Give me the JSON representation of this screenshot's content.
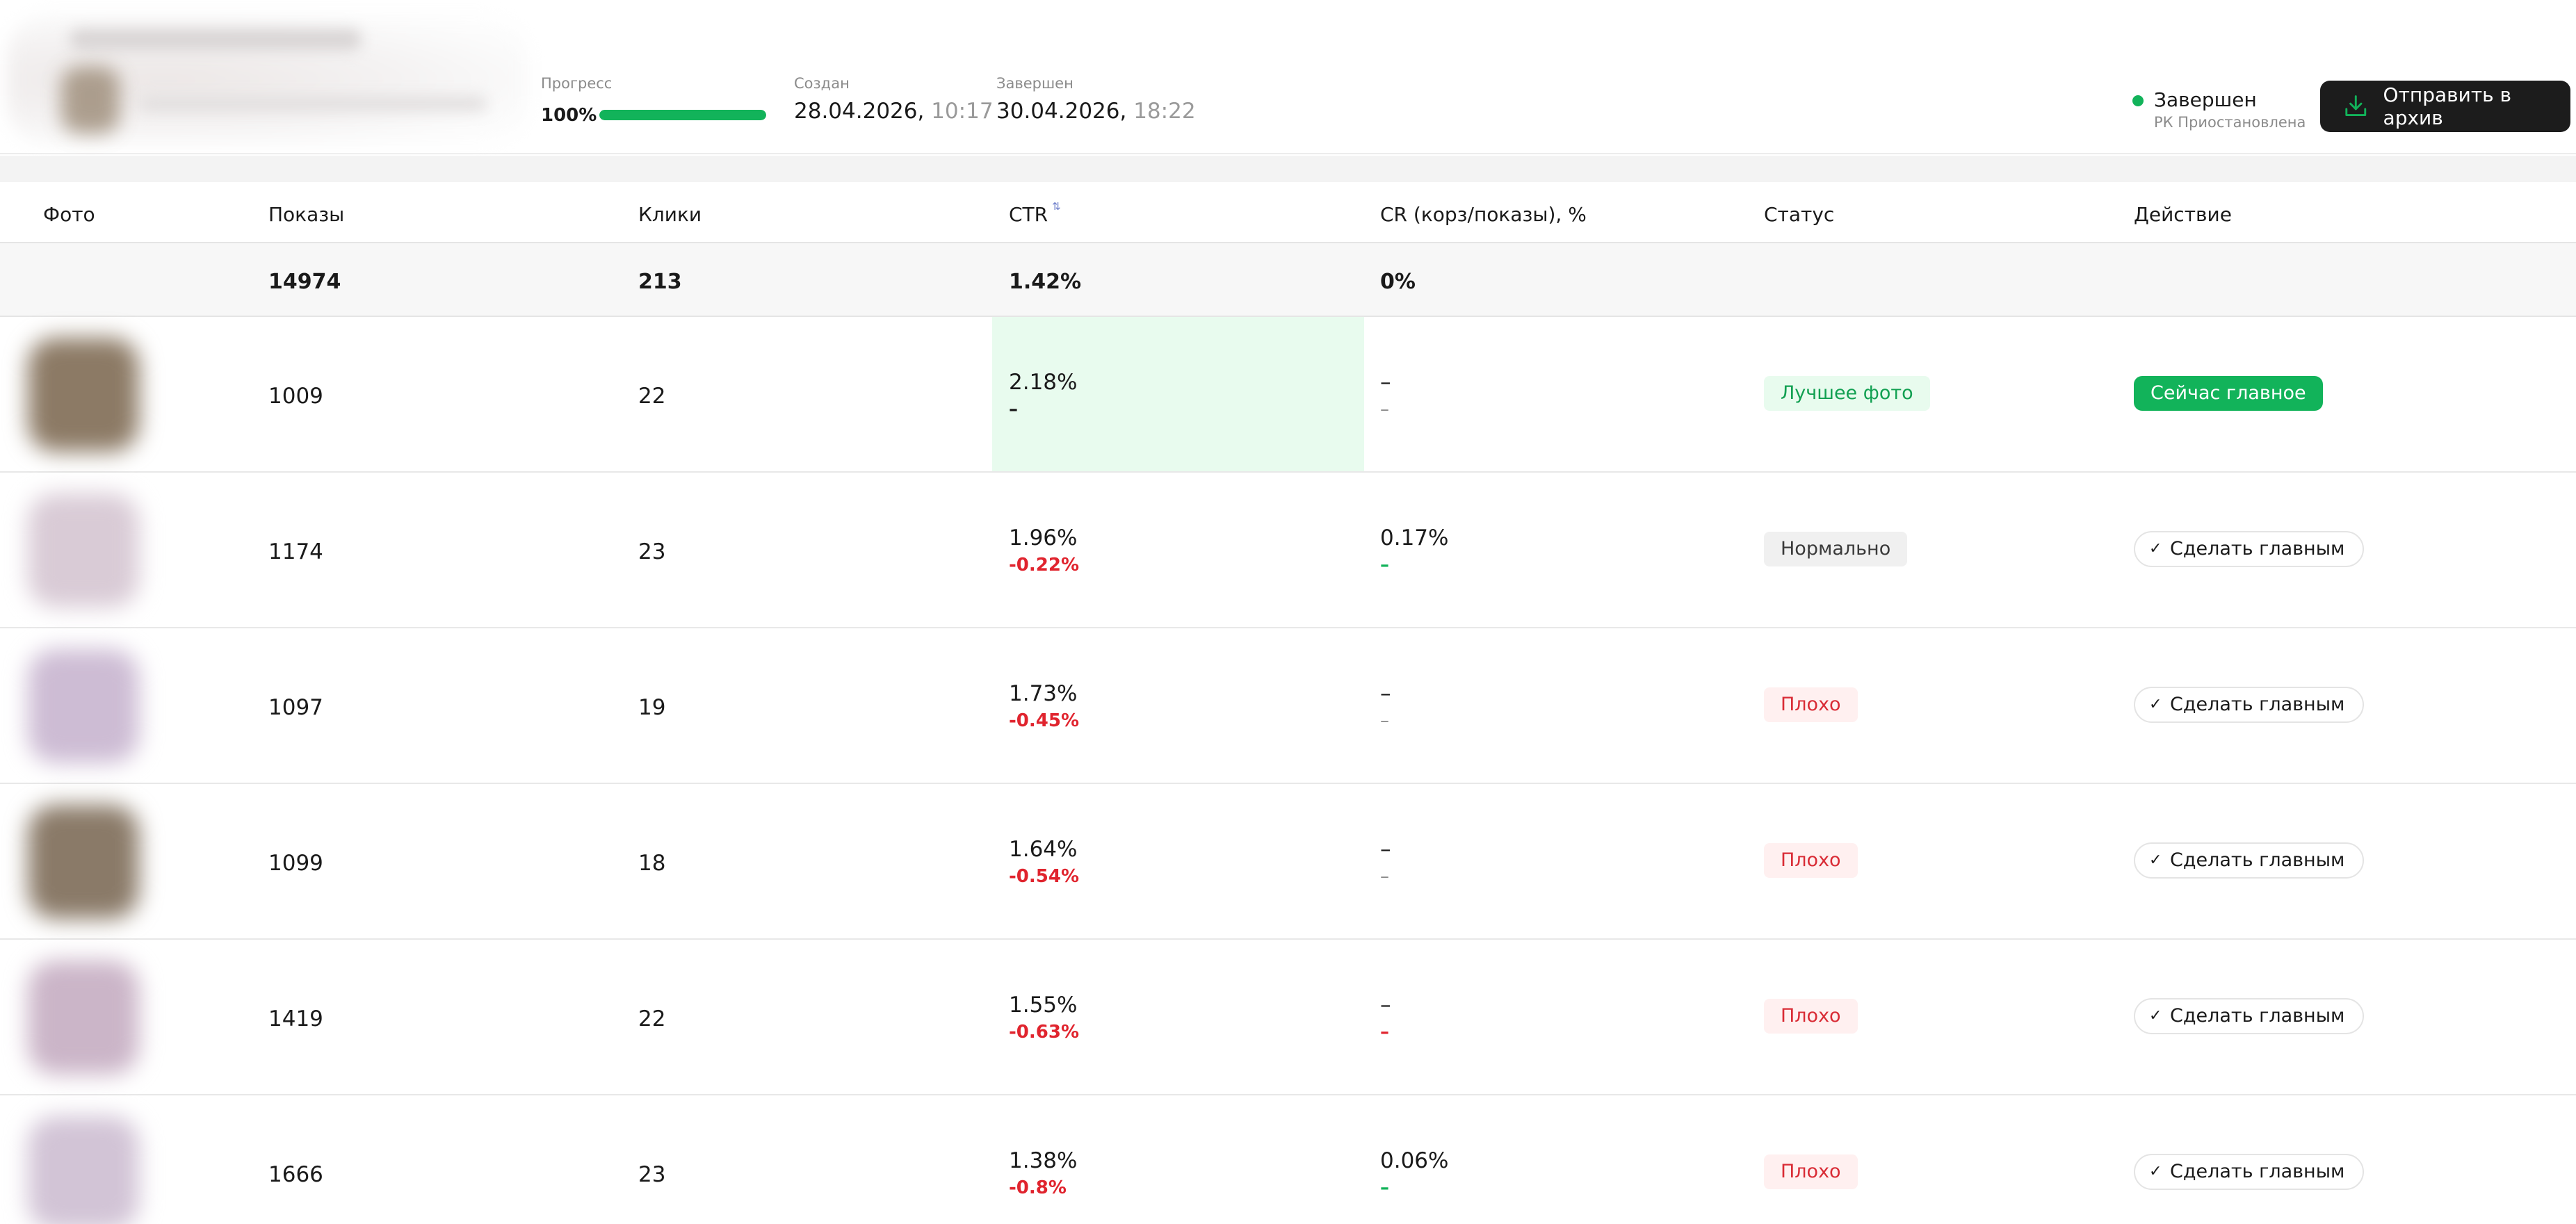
{
  "header": {
    "progress_label": "Прогресс",
    "progress_value": "100%",
    "progress_fraction": 1.0,
    "created_label": "Создан",
    "created_date": "28.04.2026,",
    "created_time": " 10:17",
    "finished_label": "Завершен",
    "finished_date": "30.04.2026,",
    "finished_time": " 18:22",
    "status_title": "Завершен",
    "status_subtitle": "РК Приостановлена",
    "archive_button": "Отправить в архив"
  },
  "table": {
    "columns": {
      "photo": "Фото",
      "impressions": "Показы",
      "clicks": "Клики",
      "ctr": "CTR",
      "cr": "CR (корз/показы), %",
      "status": "Статус",
      "action": "Действие"
    },
    "totals": {
      "impressions": "14974",
      "clicks": "213",
      "ctr": "1.42%",
      "cr": "0%"
    },
    "rows": [
      {
        "impressions": "1009",
        "clicks": "22",
        "ctr": "2.18%",
        "ctr_delta": "–",
        "cr": "–",
        "cr_delta": "–",
        "status": "Лучшее фото",
        "action": "Сейчас главное"
      },
      {
        "impressions": "1174",
        "clicks": "23",
        "ctr": "1.96%",
        "ctr_delta": "-0.22%",
        "cr": "0.17%",
        "cr_delta": "–",
        "status": "Нормально",
        "action": "Сделать главным"
      },
      {
        "impressions": "1097",
        "clicks": "19",
        "ctr": "1.73%",
        "ctr_delta": "-0.45%",
        "cr": "–",
        "cr_delta": "–",
        "status": "Плохо",
        "action": "Сделать главным"
      },
      {
        "impressions": "1099",
        "clicks": "18",
        "ctr": "1.64%",
        "ctr_delta": "-0.54%",
        "cr": "–",
        "cr_delta": "–",
        "status": "Плохо",
        "action": "Сделать главным"
      },
      {
        "impressions": "1419",
        "clicks": "22",
        "ctr": "1.55%",
        "ctr_delta": "-0.63%",
        "cr": "–",
        "cr_delta": "–",
        "status": "Плохо",
        "action": "Сделать главным"
      },
      {
        "impressions": "1666",
        "clicks": "23",
        "ctr": "1.38%",
        "ctr_delta": "-0.8%",
        "cr": "0.06%",
        "cr_delta": "–",
        "status": "Плохо",
        "action": "Сделать главным"
      }
    ]
  },
  "icons": {
    "sort": "sort-arrows-icon",
    "archive": "download-tray-icon",
    "check": "check-icon"
  },
  "colors": {
    "accent_green": "#12b35a",
    "negative_red": "#e0242e",
    "dark_button": "#1c1c1c",
    "highlight_green_bg": "#e8fbee"
  }
}
